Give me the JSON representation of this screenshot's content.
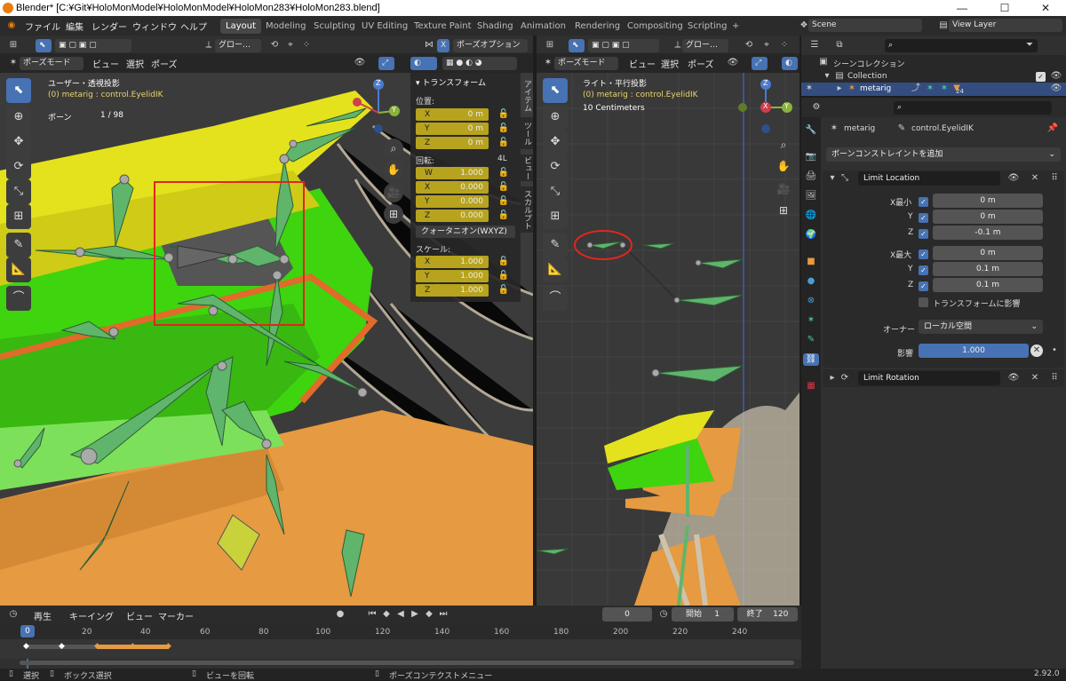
{
  "window": {
    "title": "Blender* [C:¥Git¥HoloMonModel¥HoloMonModel¥HoloMon283¥HoloMon283.blend]",
    "min": "—",
    "max": "☐",
    "close": "✕"
  },
  "menu": [
    "ファイル",
    "編集",
    "レンダー",
    "ウィンドウ",
    "ヘルプ"
  ],
  "workspaces": [
    "Layout",
    "Modeling",
    "Sculpting",
    "UV Editing",
    "Texture Paint",
    "Shading",
    "Animation",
    "Rendering",
    "Compositing",
    "Scripting"
  ],
  "workspace_add": "+",
  "scene": "Scene",
  "view_layer": "View Layer",
  "left_view": {
    "transform_orientation": "グロー…",
    "mode": "ポーズモード",
    "menus": [
      "ビュー",
      "選択",
      "ポーズ"
    ],
    "x_toggle": "X",
    "pose_options": "ポーズオプション",
    "overlay_title": "ユーザー・透視投影",
    "overlay_object": "(0) metarig : control.EyelidIK",
    "overlay_bones_label": "ボーン",
    "overlay_bones_value": "1 / 98",
    "axis_x": "X",
    "axis_y": "Y",
    "axis_z": "Z"
  },
  "npanel": {
    "header": "トランスフォーム",
    "tabs": [
      "アイテム",
      "ツール",
      "ビュー",
      "スカルプト"
    ],
    "location_label": "位置:",
    "location": [
      {
        "axis": "X",
        "value": "0 m"
      },
      {
        "axis": "Y",
        "value": "0 m"
      },
      {
        "axis": "Z",
        "value": "0 m"
      }
    ],
    "rotation_label": "回転:",
    "rotation_mode_short": "4L",
    "rotation": [
      {
        "axis": "W",
        "value": "1.000"
      },
      {
        "axis": "X",
        "value": "0.000"
      },
      {
        "axis": "Y",
        "value": "0.000"
      },
      {
        "axis": "Z",
        "value": "0.000"
      }
    ],
    "rotation_mode": "クォータニオン(WXYZ)",
    "scale_label": "スケール:",
    "scale": [
      {
        "axis": "X",
        "value": "1.000"
      },
      {
        "axis": "Y",
        "value": "1.000"
      },
      {
        "axis": "Z",
        "value": "1.000"
      }
    ]
  },
  "right_view": {
    "transform_orientation": "グロー…",
    "mode": "ポーズモード",
    "menus": [
      "ビュー",
      "選択",
      "ポーズ"
    ],
    "overlay_title": "ライト・平行投影",
    "overlay_object": "(0) metarig : control.EyelidIK",
    "overlay_scale": "10 Centimeters",
    "axis_x": "X",
    "axis_y": "Y",
    "axis_z": "Z"
  },
  "outliner": {
    "scene_collection": "シーンコレクション",
    "collection": "Collection",
    "metarig": "metarig",
    "badge": "24"
  },
  "properties": {
    "breadcrumb_object": "metarig",
    "breadcrumb_bone": "control.EyelidIK",
    "add_constraint": "ボーンコンストレイントを追加",
    "constraint1_name": "Limit Location",
    "min_x_label": "X最小",
    "min_x": "0 m",
    "min_y_label": "Y",
    "min_y": "0 m",
    "min_z_label": "Z",
    "min_z": "-0.1 m",
    "max_x_label": "X最大",
    "max_x": "0 m",
    "max_y_label": "Y",
    "max_y": "0.1 m",
    "max_z_label": "Z",
    "max_z": "0.1 m",
    "affect_transform": "トランスフォームに影響",
    "owner_label": "オーナー",
    "owner_value": "ローカル空間",
    "influence_label": "影響",
    "influence_value": "1.000",
    "constraint2_name": "Limit Rotation"
  },
  "timeline": {
    "menus": [
      "再生",
      "キーイング",
      "ビュー",
      "マーカー"
    ],
    "current_frame": "0",
    "start_label": "開始",
    "start": "1",
    "end_label": "終了",
    "end": "120",
    "ticks": [
      "0",
      "20",
      "40",
      "60",
      "80",
      "100",
      "120",
      "140",
      "160",
      "180",
      "200",
      "220",
      "240"
    ],
    "playhead": "0"
  },
  "status": {
    "select": "選択",
    "box_select": "ボックス選択",
    "rotate_view": "ビューを回転",
    "context_menu": "ポーズコンテクストメニュー",
    "version": "2.92.0"
  },
  "colors": {
    "accent": "#4772b3",
    "keyframe": "#b7a31d",
    "bone_green": "#5fb56b",
    "mesh_green": "#3ed40e",
    "mesh_yellow": "#e4e21c",
    "mesh_orange": "#e69a41"
  }
}
